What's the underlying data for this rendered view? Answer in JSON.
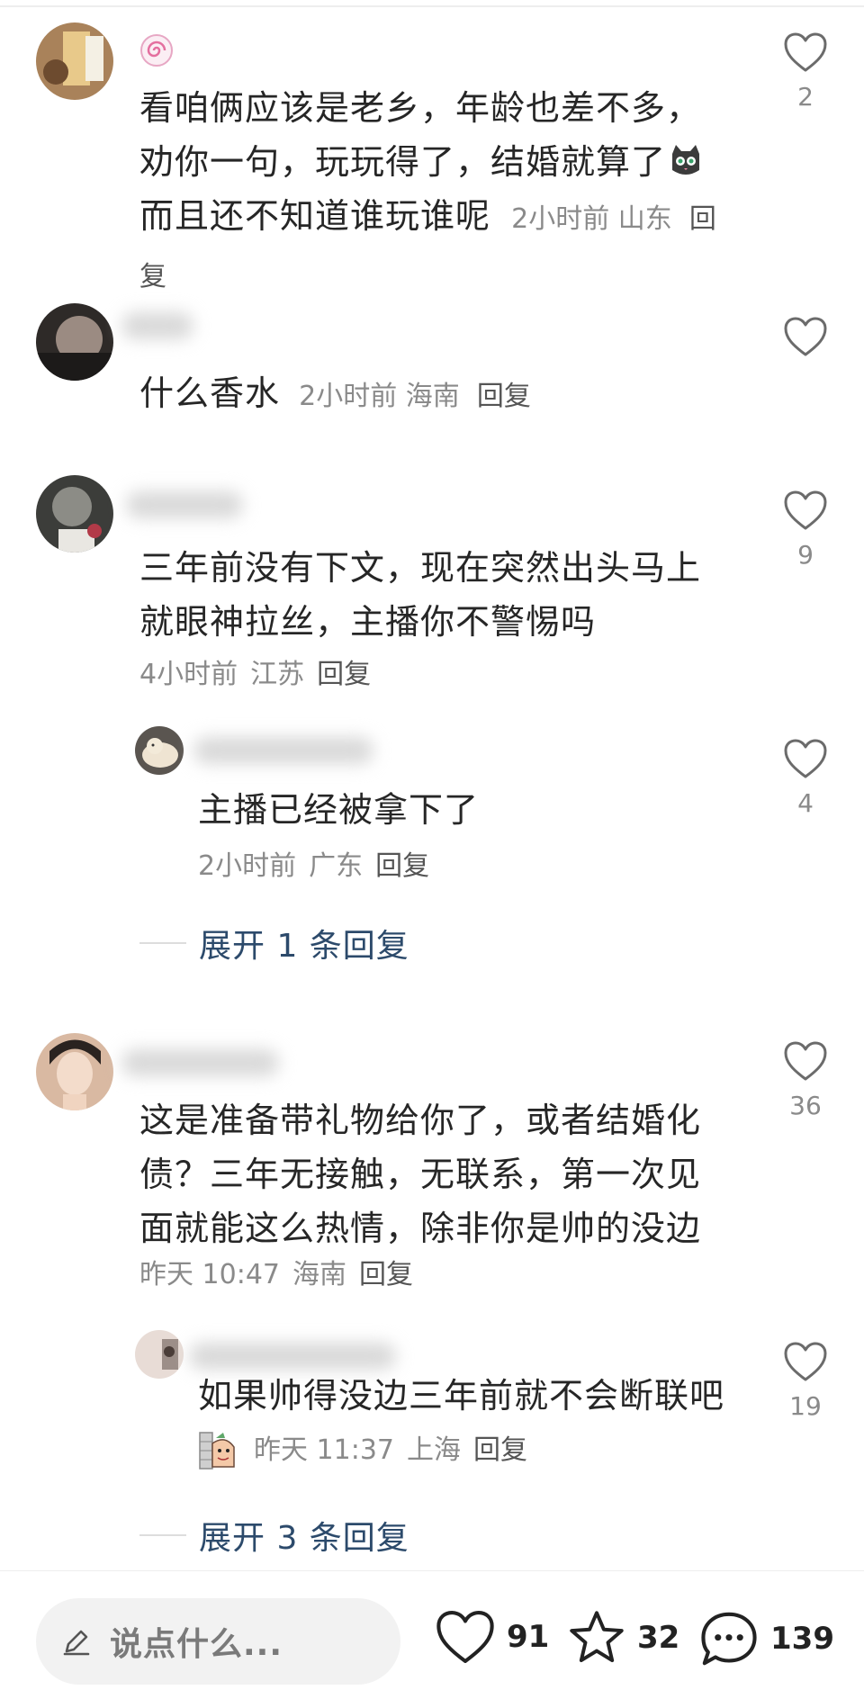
{
  "comments": [
    {
      "text": "看咱俩应该是老乡，年龄也差不多，劝你一句，玩玩得了，结婚就算了",
      "text_tail": "而且还不知道谁玩谁呢",
      "time": "2小时前",
      "location": "山东",
      "reply_label": "回复",
      "likes": "2",
      "badge_icon": "lollipop-badge-icon",
      "emoji_icon": "cat-face-emoji-icon"
    },
    {
      "text": "什么香水",
      "time": "2小时前",
      "location": "海南",
      "reply_label": "回复",
      "likes": ""
    },
    {
      "text": "三年前没有下文，现在突然出头马上就眼神拉丝，主播你不警惕吗",
      "time": "4小时前",
      "location": "江苏",
      "reply_label": "回复",
      "likes": "9",
      "reply": {
        "text": "主播已经被拿下了",
        "time": "2小时前",
        "location": "广东",
        "reply_label": "回复",
        "likes": "4"
      },
      "expand_label": "展开 1 条回复"
    },
    {
      "text": "这是准备带礼物给你了，或者结婚化债？三年无接触，无联系，第一次见面就能这么热情，除非你是帅的没边",
      "time": "昨天 10:47",
      "location": "海南",
      "reply_label": "回复",
      "likes": "36",
      "reply": {
        "text": "如果帅得没边三年前就不会断联吧",
        "time": "昨天 11:37",
        "location": "上海",
        "reply_label": "回复",
        "likes": "19",
        "emoji_icon": "wall-peek-emoji-icon"
      },
      "expand_label": "展开 3 条回复"
    }
  ],
  "bottom_bar": {
    "input_placeholder": "说点什么...",
    "likes": "91",
    "favorites": "32",
    "comments": "139"
  },
  "colors": {
    "text": "#262626",
    "meta": "#8a8a8a",
    "expand_link": "#2c4a6b",
    "input_bg": "#f2f2f2"
  }
}
